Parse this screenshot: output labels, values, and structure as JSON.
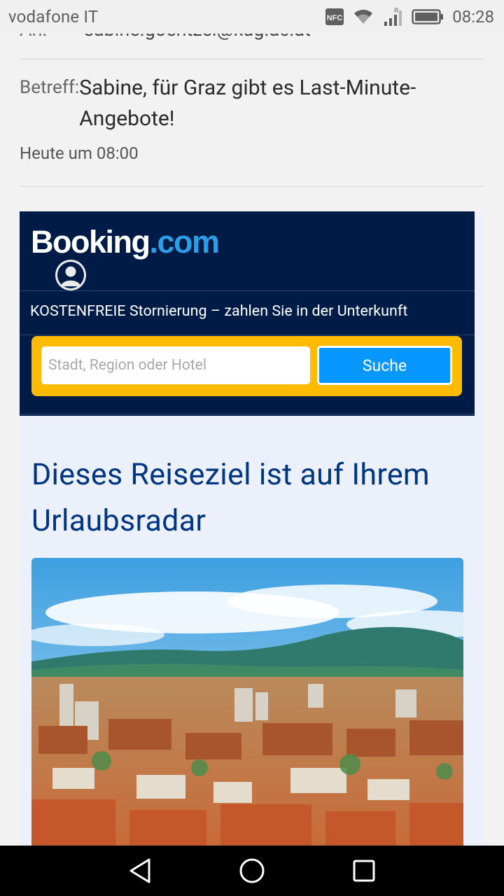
{
  "status_bar": {
    "carrier": "vodafone IT",
    "nfc_label": "NFC",
    "signal_badge": "R",
    "time": "08:28"
  },
  "mail": {
    "to_label": "An:",
    "to_value": "sabine.goentzel@kug.ac.at",
    "subject_label": "Betreff:",
    "subject": "Sabine, für Graz gibt es Last-Minute-Angebote!",
    "date": "Heute um 08:00"
  },
  "booking": {
    "logo_main": "Booking",
    "logo_suffix": ".com",
    "free_cancellation": "KOSTENFREIE Stornierung – zahlen Sie in der Unterkunft",
    "search_placeholder": "Stadt, Region oder Hotel",
    "search_button": "Suche",
    "headline": "Dieses Reiseziel ist auf Ihrem Urlaubsradar"
  },
  "colors": {
    "booking_navy": "#001c46",
    "booking_yellow": "#febb02",
    "booking_blue": "#0896ff",
    "headline_blue": "#003580"
  },
  "icons": {
    "nfc": "nfc-icon",
    "wifi": "wifi-icon",
    "signal": "signal-icon",
    "battery": "battery-icon",
    "back": "back-triangle-icon",
    "home": "home-circle-icon",
    "recents": "recents-square-icon"
  }
}
